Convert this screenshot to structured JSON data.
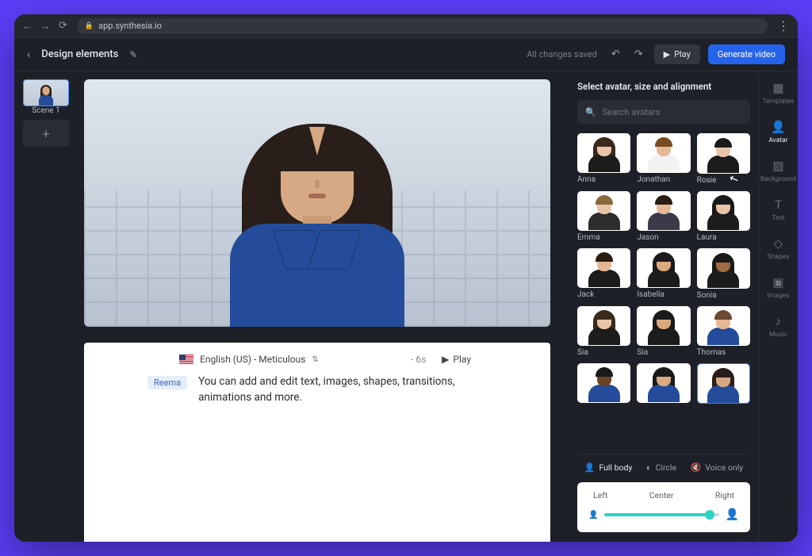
{
  "browser": {
    "url": "app.synthesia.io"
  },
  "header": {
    "title": "Design elements",
    "saved_status": "All changes saved",
    "play_label": "Play",
    "generate_label": "Generate video"
  },
  "scenes": {
    "items": [
      {
        "label": "Scene 1"
      }
    ]
  },
  "script": {
    "language": "English (US) - Meticulous",
    "duration": "6s",
    "duration_prefix": "-",
    "play_label": "Play",
    "speaker": "Reema",
    "text": "You can add and edit text, images, shapes, transitions, animations and more."
  },
  "avatar_panel": {
    "title": "Select avatar, size and alignment",
    "search_placeholder": "Search avatars",
    "avatars": [
      {
        "name": "Anna",
        "skin": "#e8c4a8",
        "hair": "#3b2a1c",
        "body": "#1c1c1c",
        "long": true
      },
      {
        "name": "Jonathan",
        "skin": "#e5b894",
        "hair": "#7a4a20",
        "body": "#f2f2f2",
        "long": false
      },
      {
        "name": "Rosie",
        "skin": "#e8c4a8",
        "hair": "#1a1a1a",
        "body": "#1c1c1c",
        "long": false
      },
      {
        "name": "Emma",
        "skin": "#e8c4a8",
        "hair": "#8a6a3c",
        "body": "#2c2c2c",
        "long": false
      },
      {
        "name": "Jason",
        "skin": "#e5b894",
        "hair": "#2a1e14",
        "body": "#3a3a4a",
        "long": false
      },
      {
        "name": "Laura",
        "skin": "#e8c4a8",
        "hair": "#1a1a1a",
        "body": "#1c1c1c",
        "long": true
      },
      {
        "name": "Jack",
        "skin": "#e5b894",
        "hair": "#2a1e14",
        "body": "#1c1c1c",
        "long": false
      },
      {
        "name": "Isabella",
        "skin": "#dba97e",
        "hair": "#1a1a1a",
        "body": "#1c1c1c",
        "long": true
      },
      {
        "name": "Sonia",
        "skin": "#a06a42",
        "hair": "#1a1a1a",
        "body": "#1c1c1c",
        "long": true
      },
      {
        "name": "Sia",
        "skin": "#e8c4a8",
        "hair": "#3b2a1c",
        "body": "#1c1c1c",
        "long": true
      },
      {
        "name": "Sia",
        "skin": "#dba97e",
        "hair": "#1a1a1a",
        "body": "#1c1c1c",
        "long": true
      },
      {
        "name": "Thomas",
        "skin": "#e5b894",
        "hair": "#6a4a30",
        "body": "#244c9a",
        "long": false
      },
      {
        "name": "",
        "skin": "#6b4426",
        "hair": "#1a1a1a",
        "body": "#244c9a",
        "long": false
      },
      {
        "name": "",
        "skin": "#dba97e",
        "hair": "#1a1a1a",
        "body": "#244c9a",
        "long": true
      },
      {
        "name": "",
        "skin": "#d6a984",
        "hair": "#2a1e1a",
        "body": "#244c9a",
        "long": true,
        "selected": true
      }
    ],
    "view_tabs": {
      "full_body": "Full body",
      "circle": "Circle",
      "voice_only": "Voice only"
    },
    "alignment": {
      "left": "Left",
      "center": "Center",
      "right": "Right"
    }
  },
  "tools": [
    {
      "id": "templates",
      "label": "Templates",
      "glyph": "▦"
    },
    {
      "id": "avatar",
      "label": "Avatar",
      "glyph": "👤",
      "active": true
    },
    {
      "id": "background",
      "label": "Background",
      "glyph": "▨"
    },
    {
      "id": "text",
      "label": "Text",
      "glyph": "T"
    },
    {
      "id": "shapes",
      "label": "Shapes",
      "glyph": "◇"
    },
    {
      "id": "images",
      "label": "Images",
      "glyph": "▣"
    },
    {
      "id": "music",
      "label": "Music",
      "glyph": "♪"
    }
  ]
}
